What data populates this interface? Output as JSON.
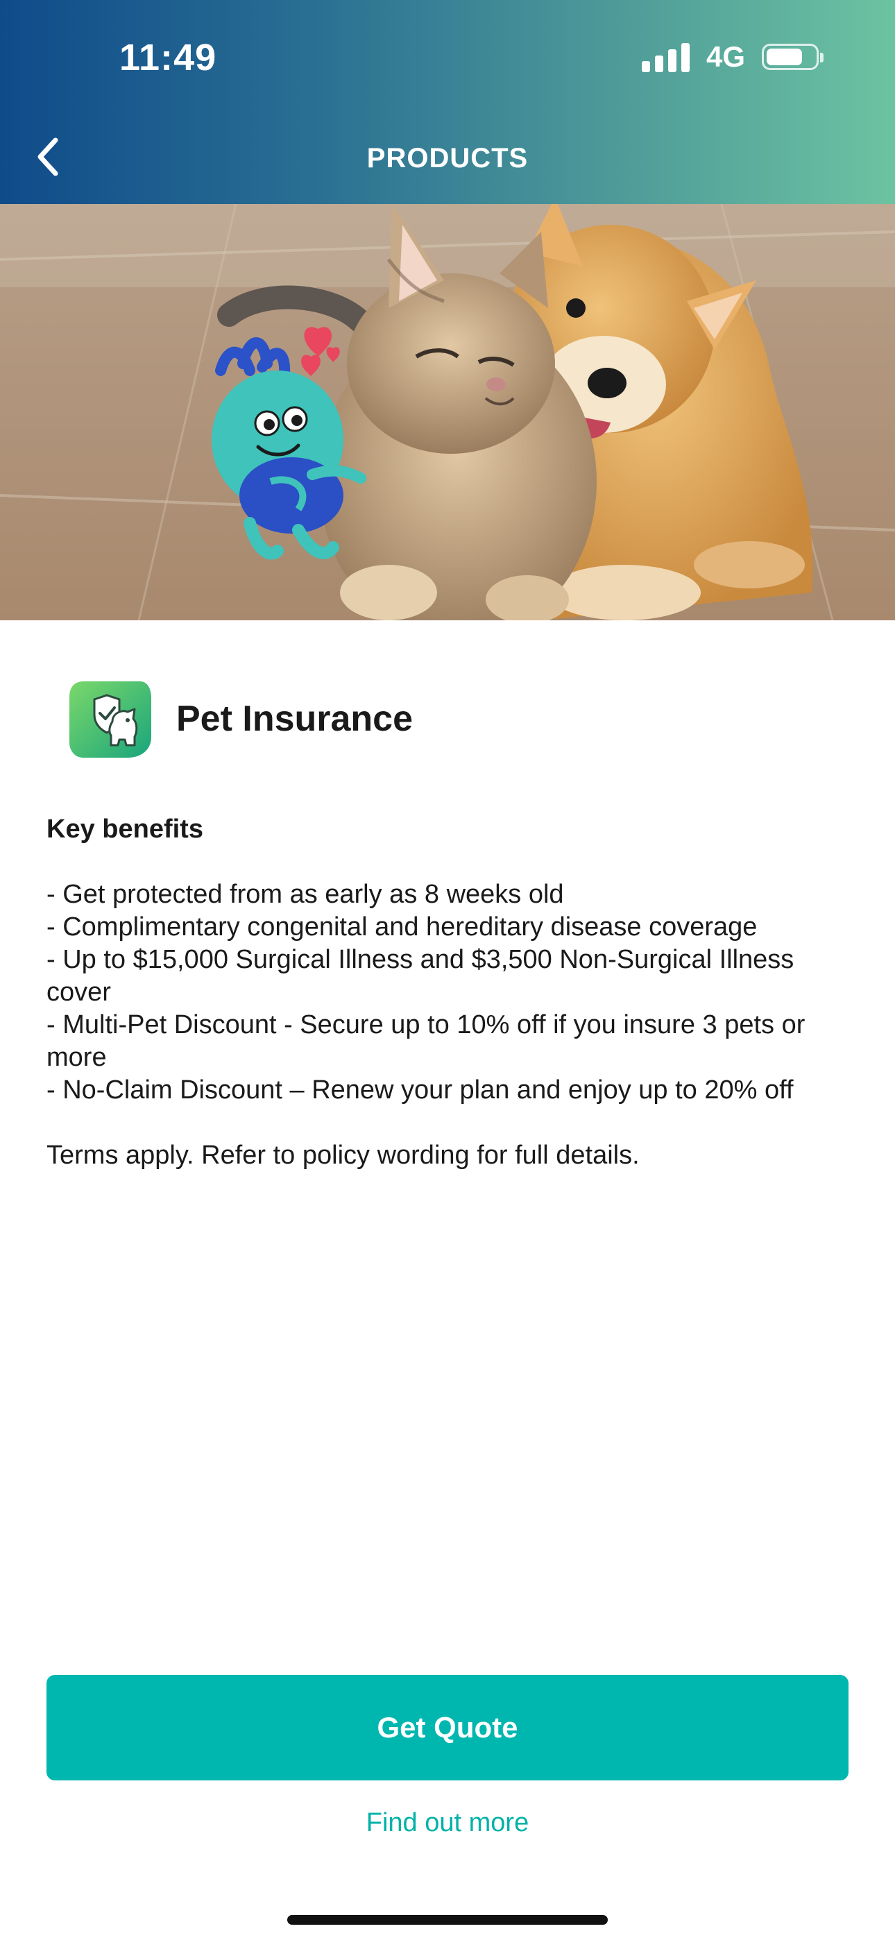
{
  "status_bar": {
    "time": "11:49",
    "network": "4G",
    "battery_level": 0.75
  },
  "header": {
    "title": "PRODUCTS"
  },
  "product": {
    "title": "Pet Insurance",
    "icon": "pet-shield-icon",
    "icon_color": "#3cb878"
  },
  "content": {
    "heading": "Key benefits",
    "benefits": [
      "- Get protected from as early as 8 weeks old",
      "- Complimentary congenital and hereditary disease coverage",
      "- Up to $15,000 Surgical Illness and $3,500 Non-Surgical Illness cover",
      "- Multi-Pet Discount - Secure up to 10% off if you insure 3 pets or more",
      "- No-Claim Discount – Renew your plan and enjoy up to 20% off"
    ],
    "terms": "Terms apply. Refer to policy wording for full details."
  },
  "actions": {
    "get_quote": "Get Quote",
    "find_out_more": "Find out more"
  },
  "colors": {
    "primary": "#00b7b0",
    "header_start": "#0f4b8a",
    "header_end": "#6cc3a1",
    "link": "#00b2a9"
  }
}
